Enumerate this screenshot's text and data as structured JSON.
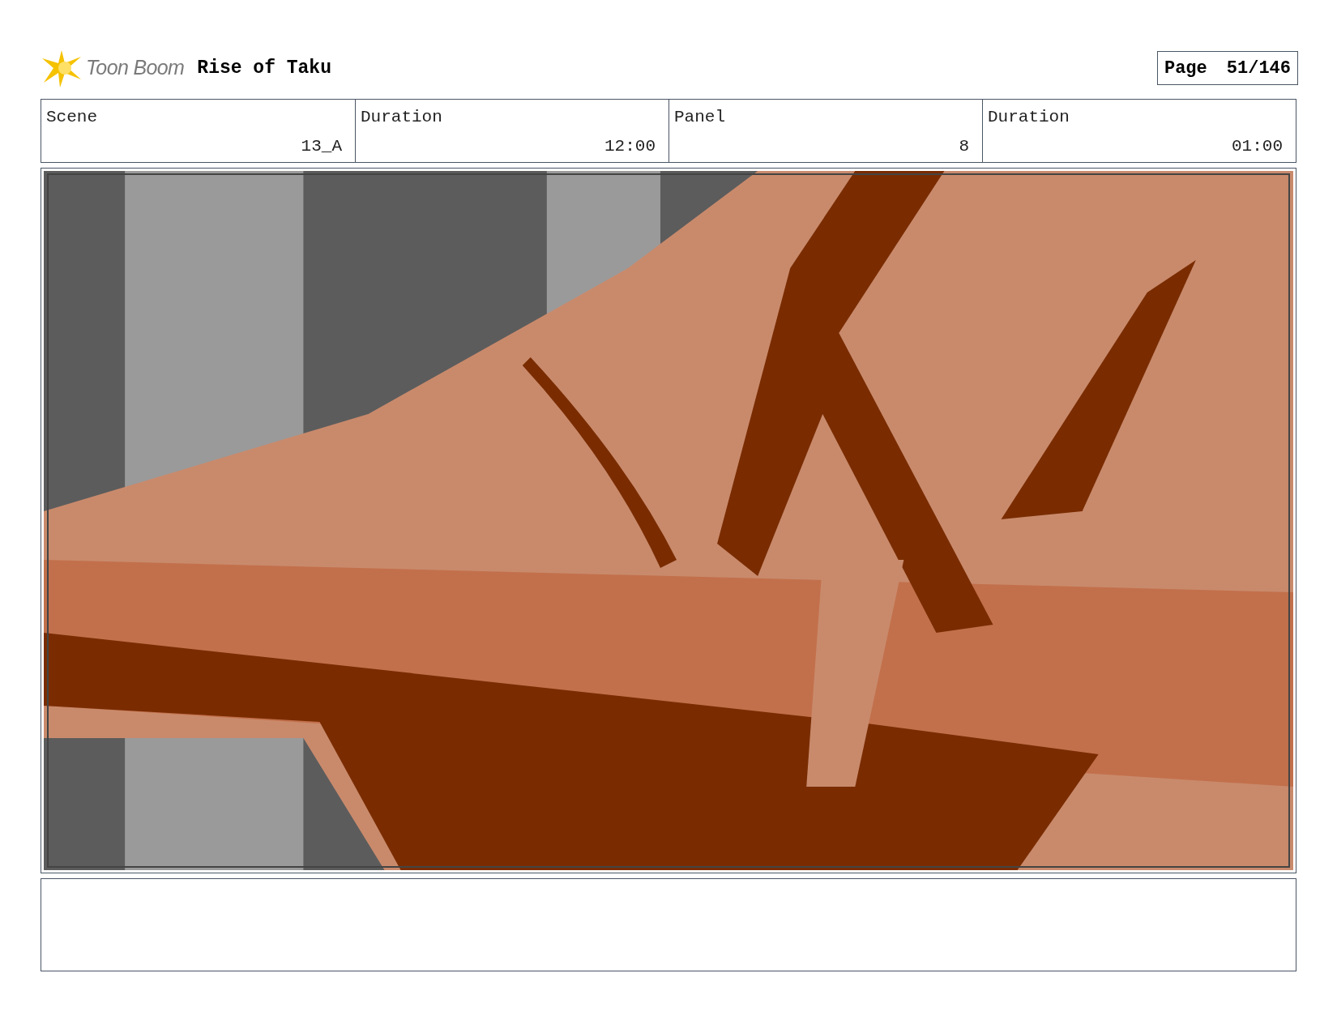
{
  "header": {
    "logo": "Toon Boom",
    "title": "Rise of Taku",
    "page_label": "Page",
    "page_number": "51/146"
  },
  "fields": [
    {
      "label": "Scene",
      "value": "13_A"
    },
    {
      "label": "Duration",
      "value": "12:00"
    },
    {
      "label": "Panel",
      "value": "8"
    },
    {
      "label": "Duration",
      "value": "01:00"
    }
  ]
}
